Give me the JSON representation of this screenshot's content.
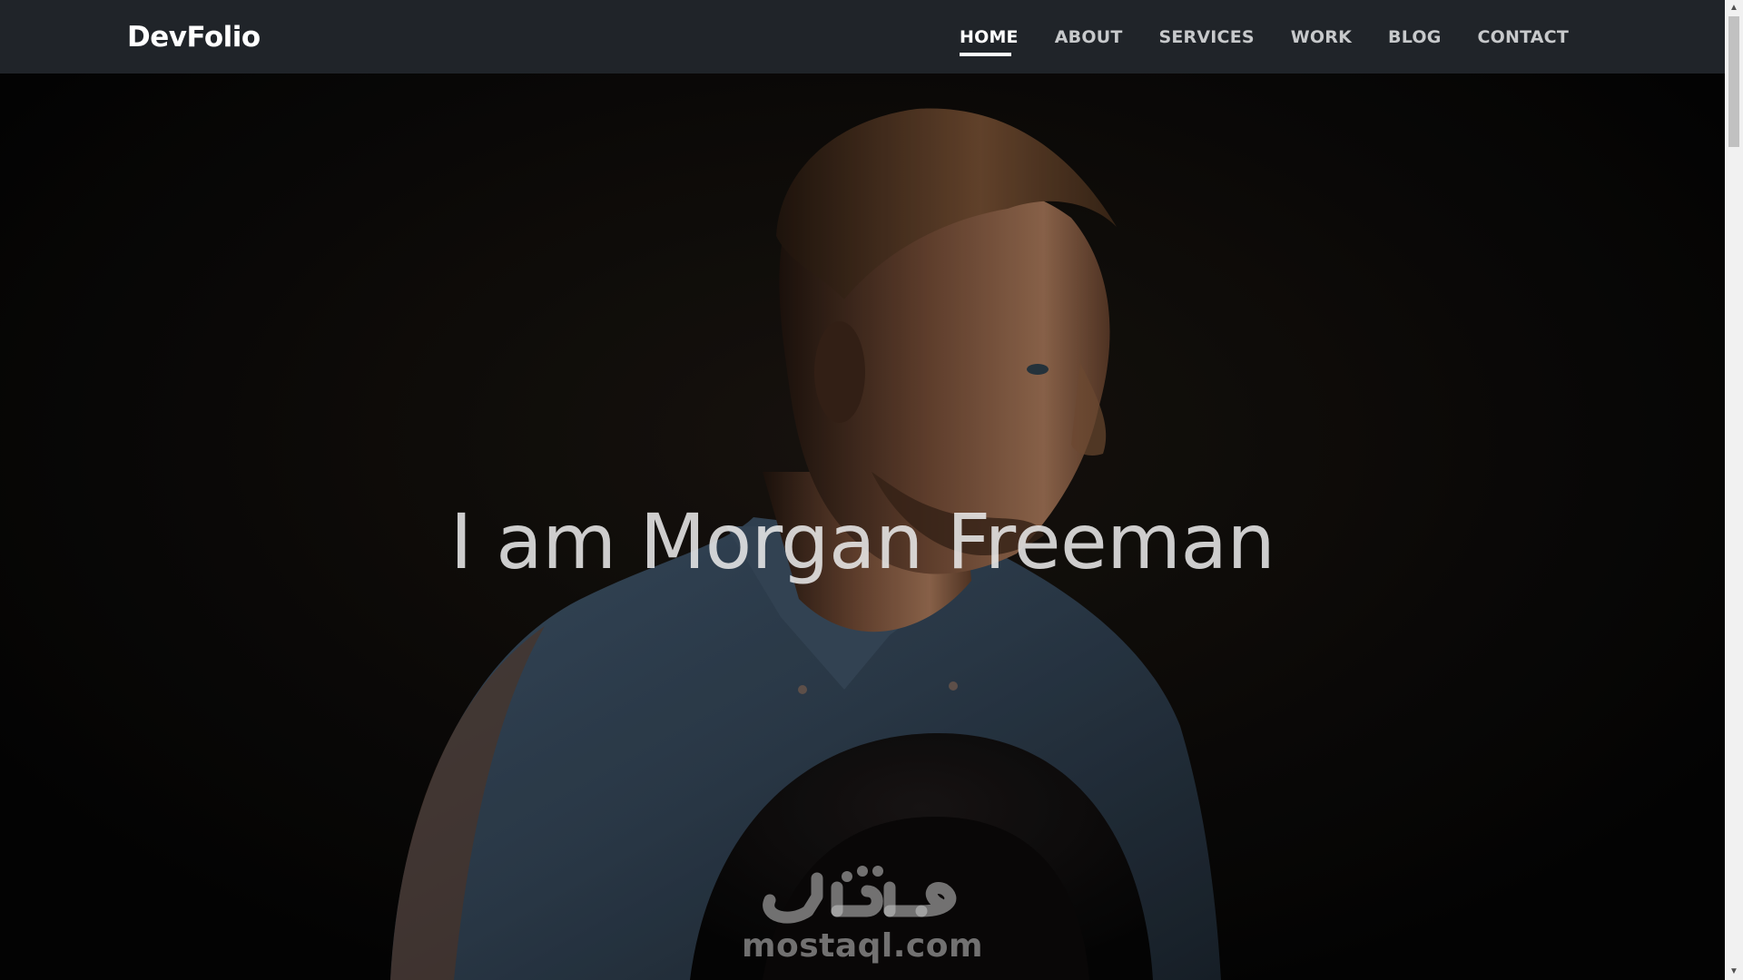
{
  "navbar": {
    "brand": "DevFolio",
    "links": [
      {
        "label": "HOME",
        "active": true
      },
      {
        "label": "ABOUT",
        "active": false
      },
      {
        "label": "SERVICES",
        "active": false
      },
      {
        "label": "WORK",
        "active": false
      },
      {
        "label": "BLOG",
        "active": false
      },
      {
        "label": "CONTACT",
        "active": false
      }
    ],
    "background_color": "#202429"
  },
  "hero": {
    "title": "I am Morgan Freeman",
    "background_image": "portrait-photo"
  },
  "watermark": {
    "logo_text": "مستقل",
    "site": "mostaql.com"
  },
  "scrollbar": {
    "up_icon": "arrow-up-icon",
    "down_icon": "arrow-down-icon"
  }
}
